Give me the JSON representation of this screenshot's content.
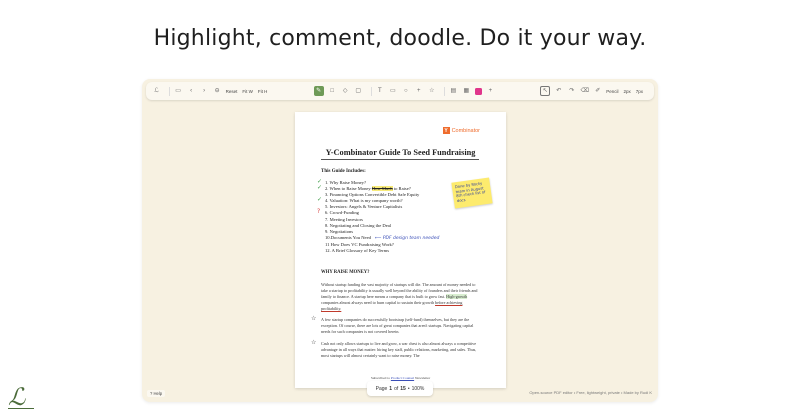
{
  "headline": "Highlight, comment, doodle. Do it your way.",
  "toolbar": {
    "reset": "Reset",
    "fit_width": "Fit W",
    "fit_height": "Fit H",
    "pencil_label": "Pencil",
    "size1": "2px",
    "size2": "7px"
  },
  "colors": {
    "accent": "#6e9a57",
    "swatch": "#e0358b",
    "brand": "#ef6c2d"
  },
  "document": {
    "brand": "Combinator",
    "brand_letter": "Y",
    "title": "Y-Combinator Guide To Seed Fundraising",
    "subtitle": "This Guide Includes:",
    "toc": [
      "1.  Why Raise Money?",
      "2.  When to Raise Money ",
      "3.  Financing Options Convertible Debt Safe Equity",
      "4.  Valuation: What is my company worth?",
      "5.  Investors: Angels & Venture Capitalists",
      "6.  Crowd-Funding",
      "7.  Meeting Investors",
      "8.  Negotiating and Closing the Deal",
      "9.  Negotiations",
      "10.Documents You Need",
      "11 How Does VC Fundraising Work?",
      "12. A Brief Glossary of Key Terms"
    ],
    "toc2_strike": "How Much",
    "toc2_tail": " to Raise?",
    "handwriting": "⟵ PDF  design  team  needed",
    "sticky": "Done  by  Rocky  team  in  August  8th \n check  list  of  docs",
    "section_heading": "WHY RAISE MONEY?",
    "para1a": "Without startup funding the vast majority of startups will die. The amount of money needed to take a startup to profitability is usually well beyond the ability of founders and their friends and family to finance. A startup here means a company that is built to grow fast. ",
    "para1_highlight": "High-growth",
    "para1b": " companies almost always need to burn capital to sustain their growth ",
    "para1_under": "before achieving profitability.",
    "para2": "A few startup companies do successfully bootstrap (self-fund) themselves, but they are the exception. Of course, there are lots of great companies that aren't startups. Navigating capital needs for such companies is not covered herein.",
    "para3": "Cash not only allows startups to live and grow, a war chest is also almost always a competitive advantage in all ways that matter: hiring key staff, public relations, marketing, and sales. Thus, most startups will almost certainly want to raise money. The",
    "footer_prefix": "Subscribed to ",
    "footer_link": "Product Counsel",
    "footer_suffix": " Newsletter"
  },
  "pager": {
    "prefix": "Page",
    "current": "1",
    "sep": "of",
    "total": "15",
    "zoom": "100%"
  },
  "help": "? Help",
  "credit": "Open-source PDF editor • Free, lightweight, private • Made by Rudi K"
}
